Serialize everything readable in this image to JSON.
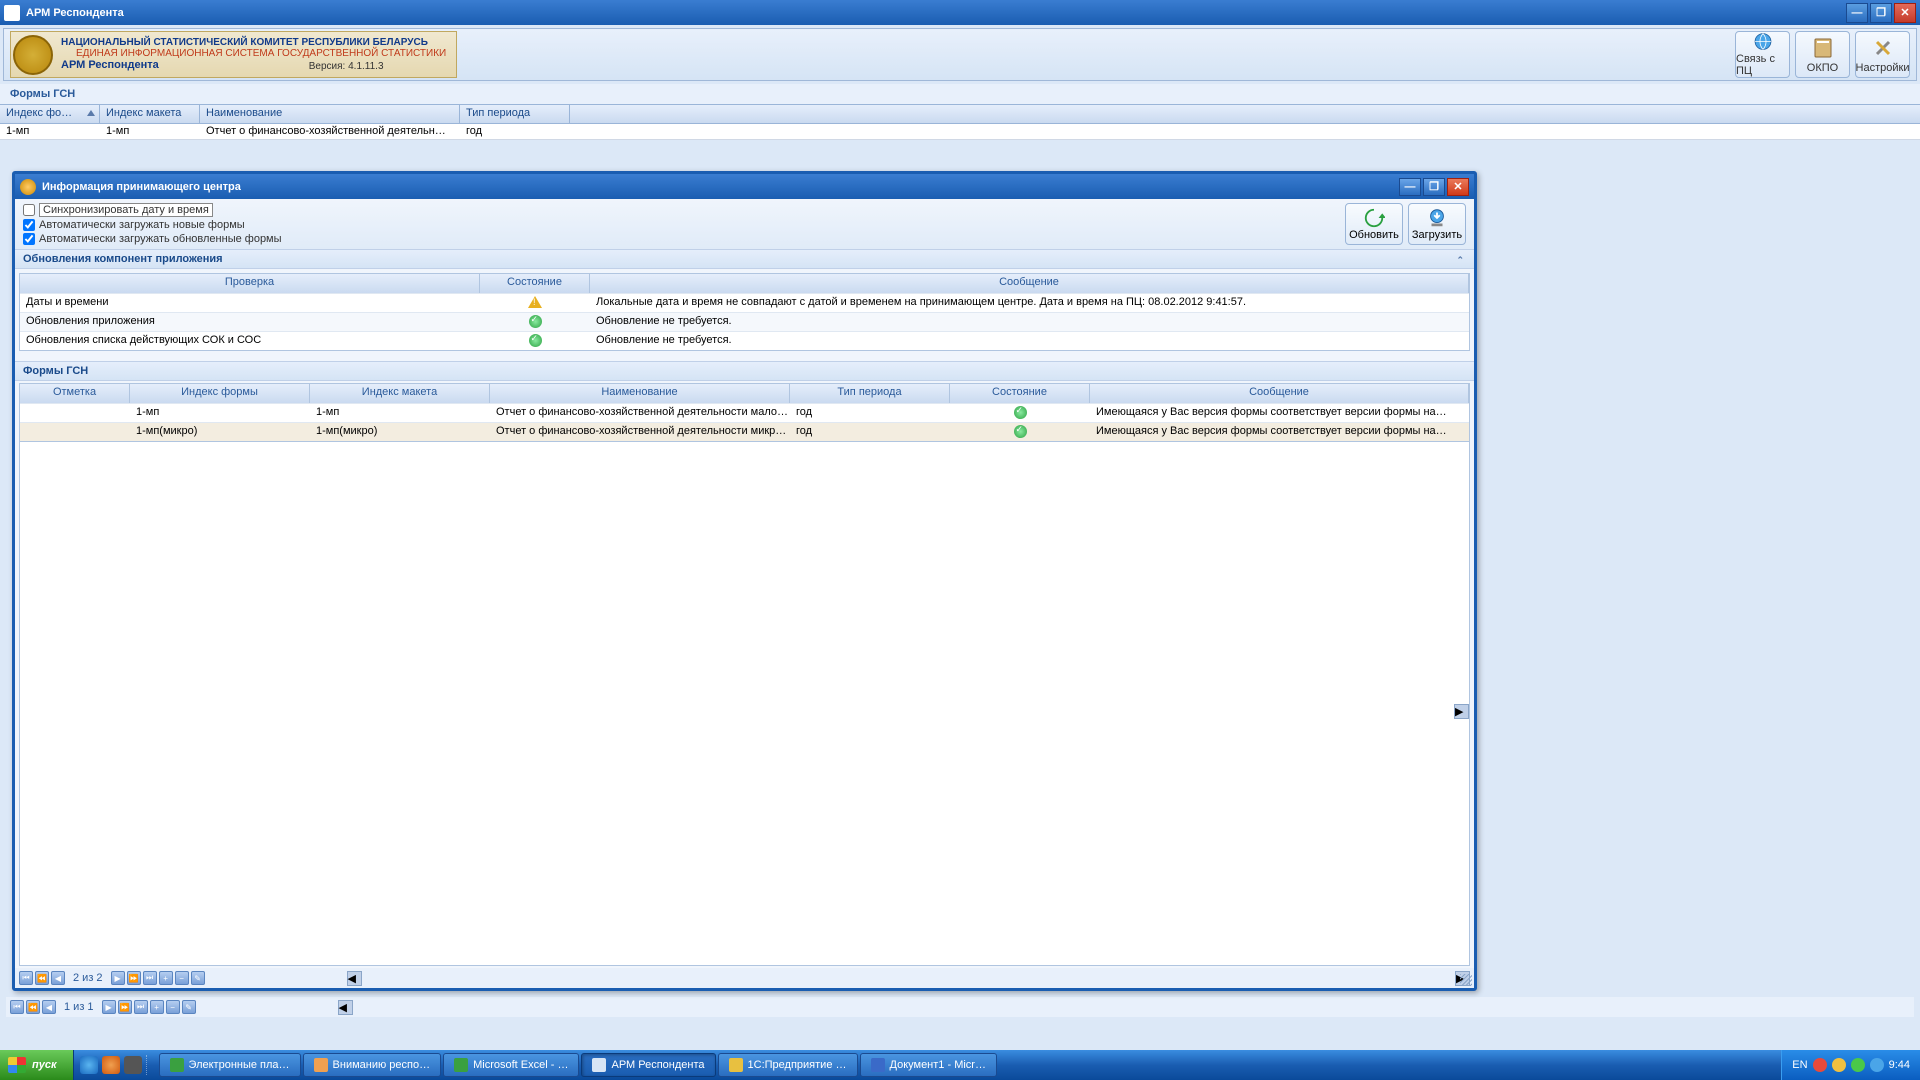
{
  "main_window": {
    "title": "АРМ Респондента"
  },
  "banner": {
    "line1": "НАЦИОНАЛЬНЫЙ СТАТИСТИЧЕСКИЙ КОМИТЕТ РЕСПУБЛИКИ БЕЛАРУСЬ",
    "line2": "ЕДИНАЯ ИНФОРМАЦИОННАЯ СИСТЕМА ГОСУДАРСТВЕННОЙ СТАТИСТИКИ",
    "line3": "АРМ Респондента",
    "version": "Версия: 4.1.11.3"
  },
  "toolbar": {
    "btn1": "Связь с ПЦ",
    "btn2": "ОКПО",
    "btn3": "Настройки"
  },
  "main_section": "Формы ГСН",
  "main_grid": {
    "headers": {
      "c1": "Индекс фо…",
      "c2": "Индекс макета",
      "c3": "Наименование",
      "c4": "Тип периода"
    },
    "row": {
      "c1": "1-мп",
      "c2": "1-мп",
      "c3": "Отчет о финансово-хозяйственной деятельн…",
      "c4": "год"
    }
  },
  "main_nav": {
    "text": "1 из 1"
  },
  "modal": {
    "title": "Информация принимающего центра",
    "checks": {
      "c1": "Синхронизировать дату и время",
      "c2": "Автоматически загружать новые формы",
      "c3": "Автоматически загружать обновленные формы"
    },
    "buttons": {
      "refresh": "Обновить",
      "download": "Загрузить"
    },
    "section1": "Обновления компонент приложения",
    "grid1": {
      "headers": {
        "c1": "Проверка",
        "c2": "Состояние",
        "c3": "Сообщение"
      },
      "rows": [
        {
          "c1": "Даты и времени",
          "status": "warn",
          "c3": "Локальные дата и время не совпадают с датой и временем на принимающем центре. Дата и время на ПЦ: 08.02.2012 9:41:57."
        },
        {
          "c1": "Обновления приложения",
          "status": "ok",
          "c3": "Обновление не требуется."
        },
        {
          "c1": "Обновления списка действующих СОК и СОС",
          "status": "ok",
          "c3": "Обновление не требуется."
        }
      ]
    },
    "section2": "Формы ГСН",
    "grid2": {
      "headers": {
        "c1": "Отметка",
        "c2": "Индекс формы",
        "c3": "Индекс макета",
        "c4": "Наименование",
        "c5": "Тип периода",
        "c6": "Состояние",
        "c7": "Сообщение"
      },
      "rows": [
        {
          "c2": "1-мп",
          "c3": "1-мп",
          "c4": "Отчет о финансово-хозяйственной деятельности мало…",
          "c5": "год",
          "c7": "Имеющаяся у Вас версия формы соответствует версии формы на…"
        },
        {
          "c2": "1-мп(микро)",
          "c3": "1-мп(микро)",
          "c4": "Отчет о финансово-хозяйственной деятельности микр…",
          "c5": "год",
          "c7": "Имеющаяся у Вас версия формы соответствует версии формы на…"
        }
      ]
    },
    "nav": {
      "text": "2 из 2"
    }
  },
  "taskbar": {
    "start": "пуск",
    "tasks": [
      "Электронные пла…",
      "Вниманию респо…",
      "Microsoft Excel - …",
      "АРМ Респондента",
      "1С:Предприятие …",
      "Документ1 - Micr…"
    ],
    "lang": "EN",
    "time": "9:44"
  }
}
